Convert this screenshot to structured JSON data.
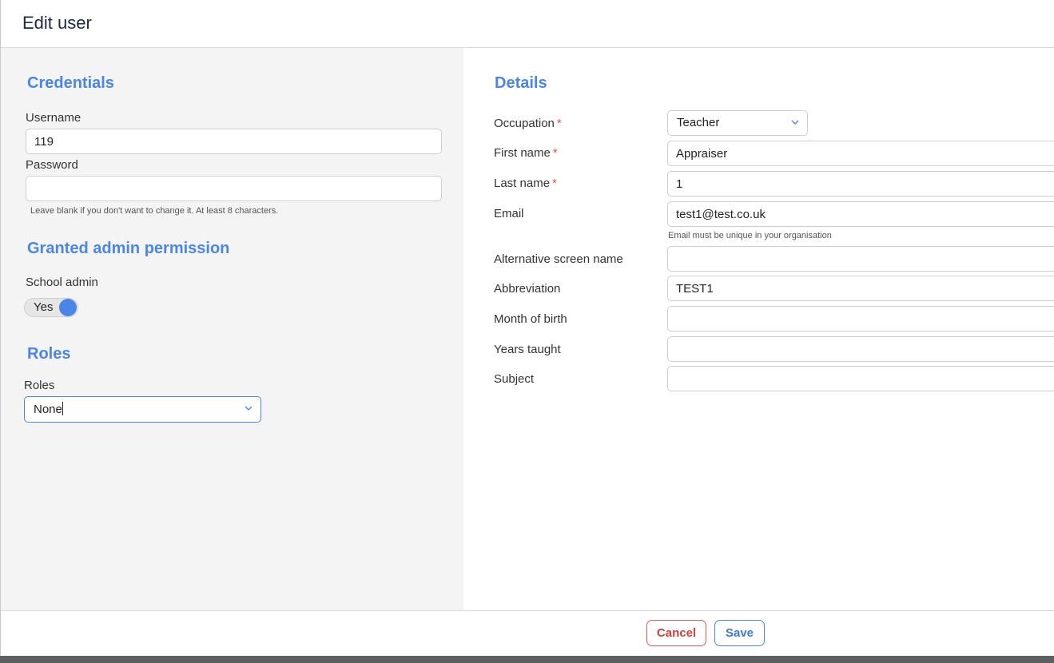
{
  "modal": {
    "title": "Edit user"
  },
  "credentials": {
    "title": "Credentials",
    "username_label": "Username",
    "username_value": "119",
    "password_label": "Password",
    "password_value": "",
    "password_help": "Leave blank if you don't want to change it. At least 8 characters."
  },
  "permissions": {
    "title": "Granted admin permission",
    "school_admin_label": "School admin",
    "school_admin_toggle": "Yes"
  },
  "roles": {
    "title": "Roles",
    "label": "Roles",
    "selected": "None"
  },
  "details": {
    "title": "Details",
    "occupation_label": "Occupation",
    "occupation_value": "Teacher",
    "first_name_label": "First name",
    "first_name_value": "Appraiser",
    "last_name_label": "Last name",
    "last_name_value": "1",
    "email_label": "Email",
    "email_value": "test1@test.co.uk",
    "email_help": "Email must be unique in your organisation",
    "alt_screen_name_label": "Alternative screen name",
    "alt_screen_name_value": "",
    "abbreviation_label": "Abbreviation",
    "abbreviation_value": "TEST1",
    "month_of_birth_label": "Month of birth",
    "month_of_birth_value": "",
    "years_taught_label": "Years taught",
    "years_taught_value": "",
    "subject_label": "Subject",
    "subject_value": "",
    "required_marker": "*"
  },
  "footer": {
    "cancel_label": "Cancel",
    "save_label": "Save"
  },
  "colors": {
    "accent": "#4a86e8",
    "danger": "#d43f3a",
    "panel_bg": "#f4f4f4"
  },
  "icons": {
    "dropdown": "chevron-down-icon"
  }
}
